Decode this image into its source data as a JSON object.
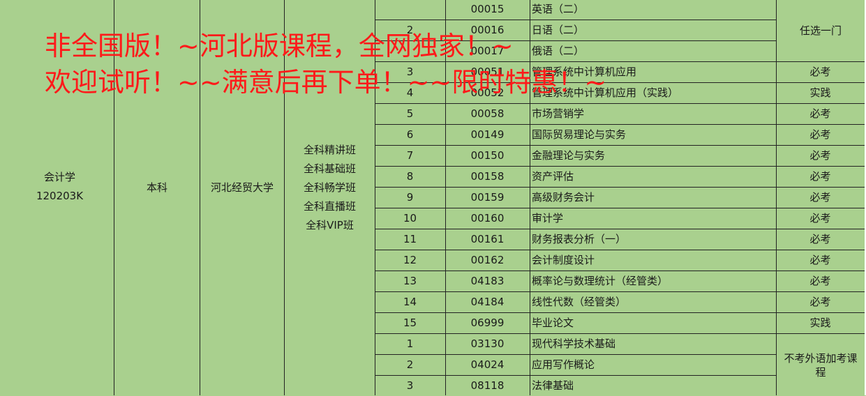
{
  "major": {
    "name": "会计学",
    "code": "120203K"
  },
  "level": "本科",
  "university": "河北经贸大学",
  "classes": [
    "全科精讲班",
    "全科基础班",
    "全科畅学班",
    "全科直播班",
    "全科VIP班"
  ],
  "banner": {
    "line1": "非全国版！~河北版课程，全网独家！~",
    "line2": "欢迎试听！~~满意后再下单！~~限时特惠！~"
  },
  "courses": [
    {
      "no": "",
      "code": "00015",
      "name": "英语（二）",
      "req": ""
    },
    {
      "no": "2",
      "code": "00016",
      "name": "日语（二）",
      "req": ""
    },
    {
      "no": "",
      "code": "00017",
      "name": "俄语（二）",
      "req": ""
    },
    {
      "no": "3",
      "code": "00051",
      "name": "管理系统中计算机应用",
      "req": "必考"
    },
    {
      "no": "4",
      "code": "00052",
      "name": "管理系统中计算机应用（实践）",
      "req": "实践"
    },
    {
      "no": "5",
      "code": "00058",
      "name": "市场营销学",
      "req": "必考"
    },
    {
      "no": "6",
      "code": "00149",
      "name": "国际贸易理论与实务",
      "req": "必考"
    },
    {
      "no": "7",
      "code": "00150",
      "name": "金融理论与实务",
      "req": "必考"
    },
    {
      "no": "8",
      "code": "00158",
      "name": "资产评估",
      "req": "必考"
    },
    {
      "no": "9",
      "code": "00159",
      "name": "高级财务会计",
      "req": "必考"
    },
    {
      "no": "10",
      "code": "00160",
      "name": "审计学",
      "req": "必考"
    },
    {
      "no": "11",
      "code": "00161",
      "name": "财务报表分析（一）",
      "req": "必考"
    },
    {
      "no": "12",
      "code": "00162",
      "name": "会计制度设计",
      "req": "必考"
    },
    {
      "no": "13",
      "code": "04183",
      "name": "概率论与数理统计（经管类）",
      "req": "必考"
    },
    {
      "no": "14",
      "code": "04184",
      "name": "线性代数（经管类）",
      "req": "必考"
    },
    {
      "no": "15",
      "code": "06999",
      "name": "毕业论文",
      "req": "实践"
    },
    {
      "no": "1",
      "code": "03130",
      "name": "现代科学技术基础",
      "req": ""
    },
    {
      "no": "2",
      "code": "04024",
      "name": "应用写作概论",
      "req": ""
    },
    {
      "no": "3",
      "code": "08118",
      "name": "法律基础",
      "req": ""
    }
  ],
  "merged_notes": {
    "elective": "任选一门",
    "extra": [
      "不考外语加考课",
      "程"
    ]
  }
}
